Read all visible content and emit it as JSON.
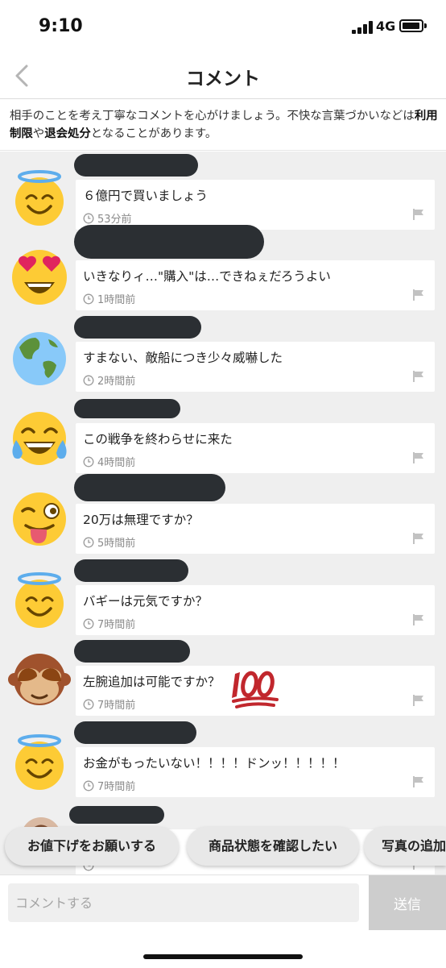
{
  "status_bar": {
    "time": "9:10",
    "network": "4G"
  },
  "nav": {
    "title": "コメント"
  },
  "notice": {
    "part1": "相手のことを考え丁寧なコメントを心がけましょう。不快な言葉づかいなどは",
    "bold1": "利用制限",
    "part2": "や",
    "bold2": "退会処分",
    "part3": "となることがあります。"
  },
  "comments": [
    {
      "avatar": "halo-smile-icon",
      "text": "６億円で買いましょう",
      "time": "53分前"
    },
    {
      "avatar": "heart-eyes-icon",
      "text": "いきなりィ…\"購入\"は…できねぇだろうよい",
      "time": "1時間前"
    },
    {
      "avatar": "globe-icon",
      "text": "すまない、敵船につき少々威嚇した",
      "time": "2時間前"
    },
    {
      "avatar": "tears-of-joy-icon",
      "text": "この戦争を終わらせに来た",
      "time": "4時間前"
    },
    {
      "avatar": "winking-tongue-icon",
      "text": "20万は無理ですか？",
      "time": "5時間前"
    },
    {
      "avatar": "halo-smile-icon",
      "text": "バギーは元気ですか？",
      "time": "7時間前"
    },
    {
      "avatar": "see-no-evil-monkey-icon",
      "text": "左腕追加は可能ですか？",
      "time": "7時間前",
      "extra_icon": "hundred-points-icon"
    },
    {
      "avatar": "halo-smile-icon",
      "text": "お金がもったいない！！！！ドンッ！！！！！",
      "time": "7時間前"
    },
    {
      "avatar": "person-photo-icon",
      "text": "",
      "time": ""
    }
  ],
  "suggestions": [
    "お値下げをお願いする",
    "商品状態を確認したい",
    "写真の追加"
  ],
  "input": {
    "placeholder": "コメントする",
    "send_label": "送信"
  },
  "colors": {
    "name_bar": "#2b2f33",
    "list_bg": "#efefef",
    "send_bg": "#cdcdcd"
  }
}
